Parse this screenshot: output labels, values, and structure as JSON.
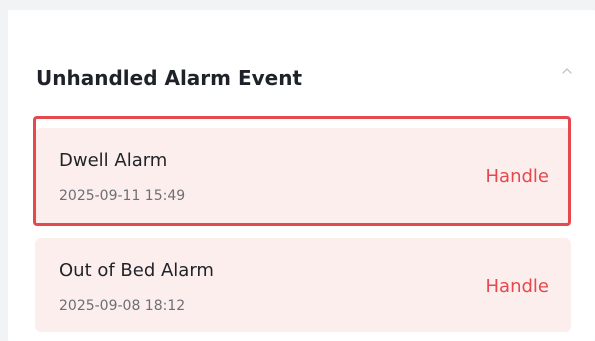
{
  "section": {
    "title": "Unhandled Alarm Event",
    "collapse_icon": "chevron-up-icon"
  },
  "alarms": [
    {
      "name": "Dwell Alarm",
      "time": "2025-09-11 15:49",
      "action": "Handle",
      "highlighted": true
    },
    {
      "name": "Out of Bed Alarm",
      "time": "2025-09-08 18:12",
      "action": "Handle",
      "highlighted": false
    }
  ],
  "colors": {
    "accent": "#e5484d",
    "card_background": "#fdeeee",
    "title_text": "#1f2329",
    "muted_text": "#6b6f76"
  }
}
